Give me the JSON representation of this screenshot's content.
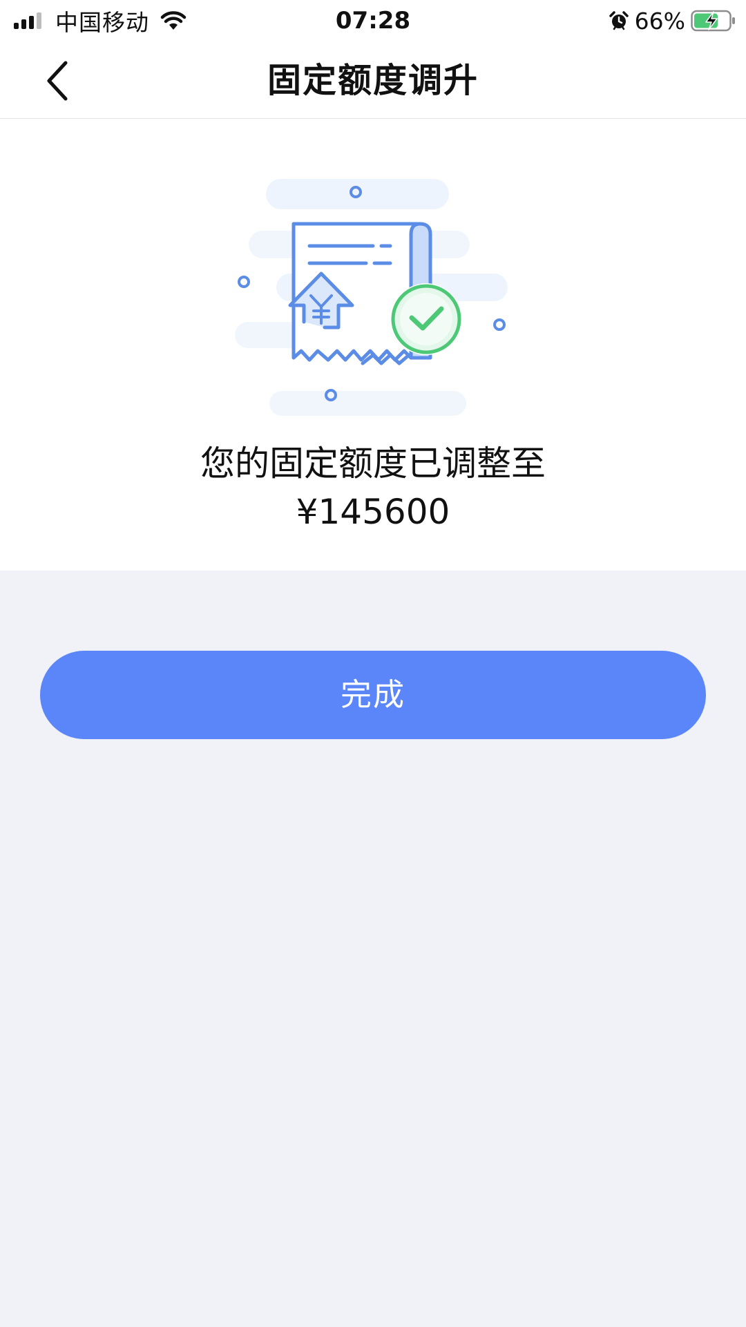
{
  "status_bar": {
    "carrier": "中国移动",
    "time": "07:28",
    "battery_percent": "66%",
    "icons": [
      "signal-icon",
      "wifi-icon",
      "alarm-icon",
      "battery-charging-icon"
    ]
  },
  "nav": {
    "title": "固定额度调升",
    "back_icon": "chevron-left-icon"
  },
  "result": {
    "illustration_icon": "receipt-approved-icon",
    "message": "您的固定额度已调整至",
    "amount": "¥145600"
  },
  "actions": {
    "done_label": "完成"
  },
  "colors": {
    "accent": "#5b86f9",
    "success": "#4cc876",
    "page_background": "#f0f2f7",
    "panel_background": "#ffffff"
  }
}
